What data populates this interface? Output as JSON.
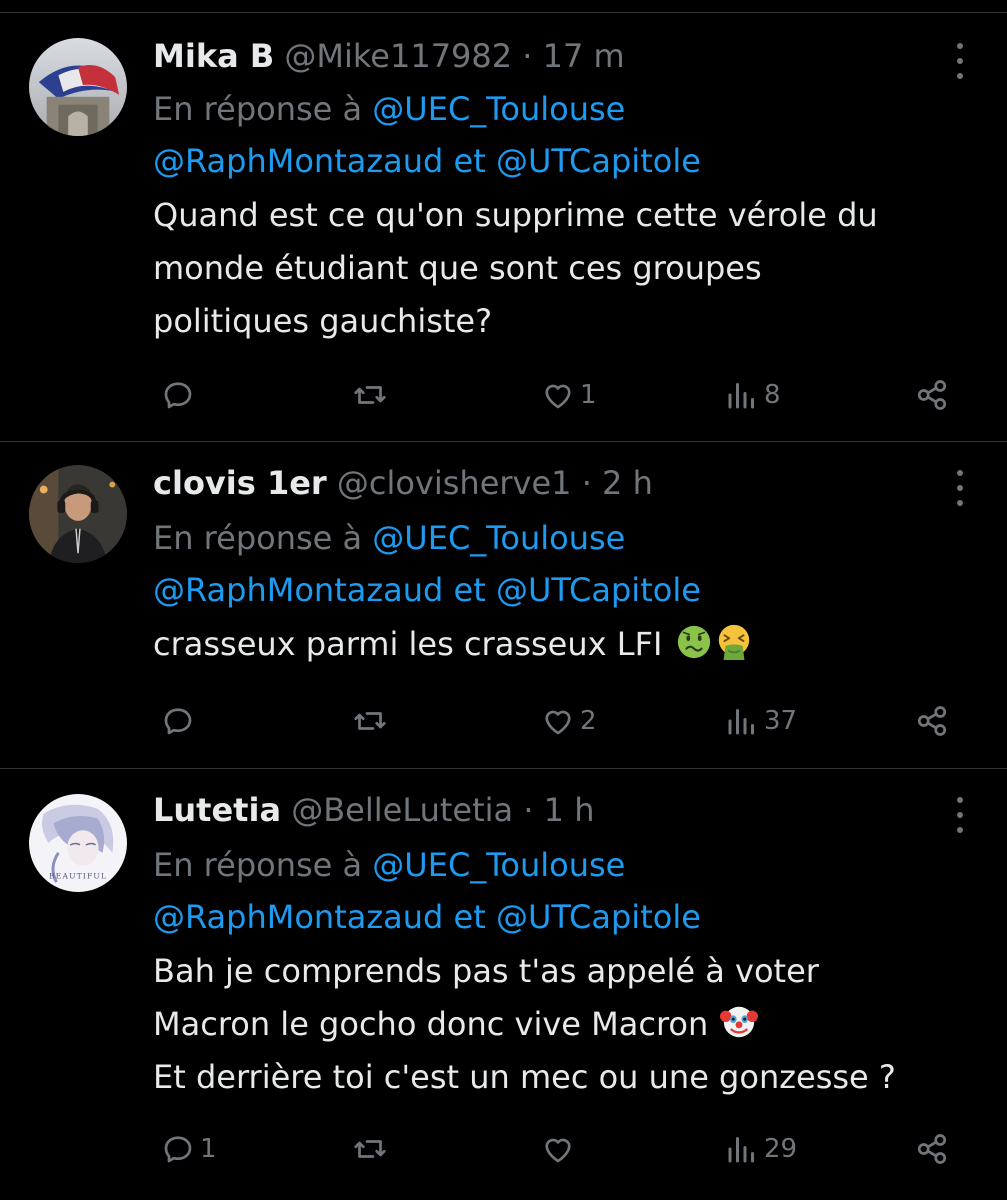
{
  "tweets": [
    {
      "name": "Mika B",
      "handle": "@Mike117982",
      "separator": "·",
      "time": "17 m",
      "reply_prefix": "En réponse à",
      "mention1": "@UEC_Toulouse",
      "mention2": "@RaphMontazaud",
      "connector": "et",
      "mention3": "@UTCapitole",
      "body_lines": [
        "Quand est ce qu'on supprime cette vérole du",
        "monde étudiant que sont ces groupes",
        "politiques gauchiste?"
      ],
      "replies": "",
      "likes": "1",
      "views": "8"
    },
    {
      "name": "clovis 1er",
      "handle": "@clovisherve1",
      "separator": "·",
      "time": "2 h",
      "reply_prefix": "En réponse à",
      "mention1": "@UEC_Toulouse",
      "mention2": "@RaphMontazaud",
      "connector": "et",
      "mention3": "@UTCapitole",
      "body_lines": [
        "crasseux parmi les crasseux LFI "
      ],
      "emojis": [
        "nauseated-face",
        "face-vomiting"
      ],
      "replies": "",
      "likes": "2",
      "views": "37"
    },
    {
      "name": "Lutetia",
      "handle": "@BelleLutetia",
      "separator": "·",
      "time": "1 h",
      "reply_prefix": "En réponse à",
      "mention1": "@UEC_Toulouse",
      "mention2": "@RaphMontazaud",
      "connector": "et",
      "mention3": "@UTCapitole",
      "body_lines": [
        "Bah je comprends pas t'as appelé à voter",
        "Macron le gocho donc vive Macron ",
        "Et derrière toi c'est un mec ou une gonzesse ?"
      ],
      "emojis": [
        "clown-face"
      ],
      "avatar_text": "BEAUTIFUL",
      "replies": "1",
      "likes": "",
      "views": "29"
    }
  ],
  "colors": {
    "background": "#000000",
    "text": "#e7e9ea",
    "muted": "#71767b",
    "link": "#1d9bf0",
    "divider": "#2f3336"
  },
  "icons": [
    "reply-icon",
    "retweet-icon",
    "like-icon",
    "views-icon",
    "share-icon",
    "more-icon"
  ]
}
